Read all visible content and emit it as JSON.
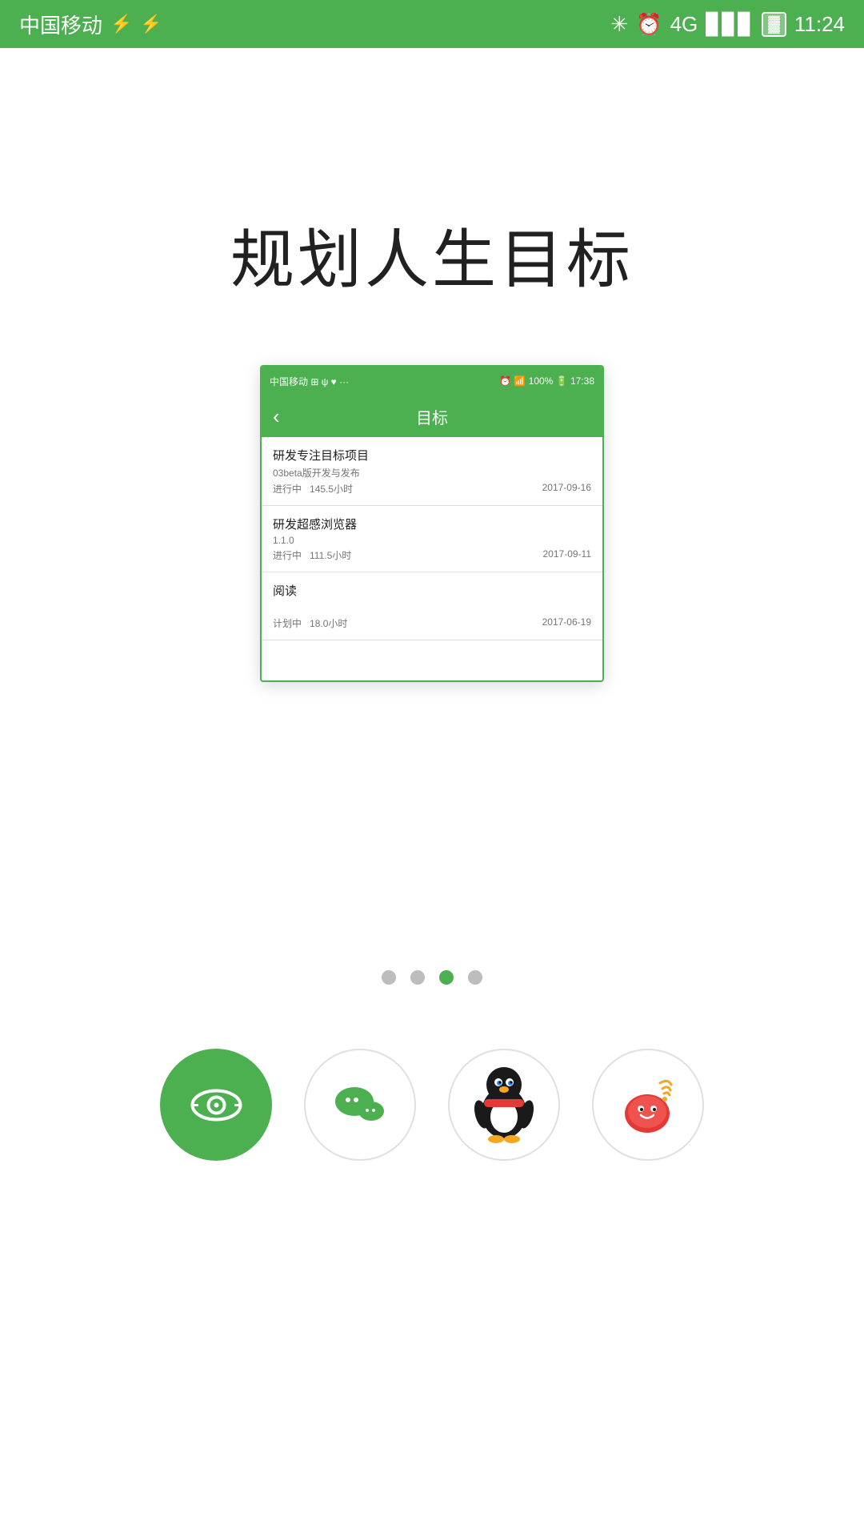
{
  "statusBar": {
    "carrier": "中国移动",
    "time": "11:24",
    "icons": [
      "usb",
      "usb2"
    ]
  },
  "pageTitle": "规划人生目标",
  "mockup": {
    "statusBar": {
      "left": "中国移动  ⊞ ψ ♥ ···",
      "right": "⏰ 📶 100% 🔋 17:38"
    },
    "header": {
      "back": "‹",
      "title": "目标"
    },
    "items": [
      {
        "title": "研发专注目标项目",
        "subtitle": "03beta版开发与发布",
        "status": "进行中",
        "hours": "145.5小时",
        "date": "2017-09-16"
      },
      {
        "title": "研发超感浏览器",
        "subtitle": "1.1.0",
        "status": "进行中",
        "hours": "111.5小时",
        "date": "2017-09-11"
      },
      {
        "title": "阅读",
        "subtitle": "",
        "status": "计划中",
        "hours": "18.0小时",
        "date": "2017-06-19"
      }
    ]
  },
  "dots": {
    "total": 4,
    "active": 2
  },
  "apps": [
    {
      "name": "green-camera",
      "label": "绿镜"
    },
    {
      "name": "wechat",
      "label": "微信"
    },
    {
      "name": "qq",
      "label": "QQ"
    },
    {
      "name": "weibo",
      "label": "微博"
    }
  ]
}
